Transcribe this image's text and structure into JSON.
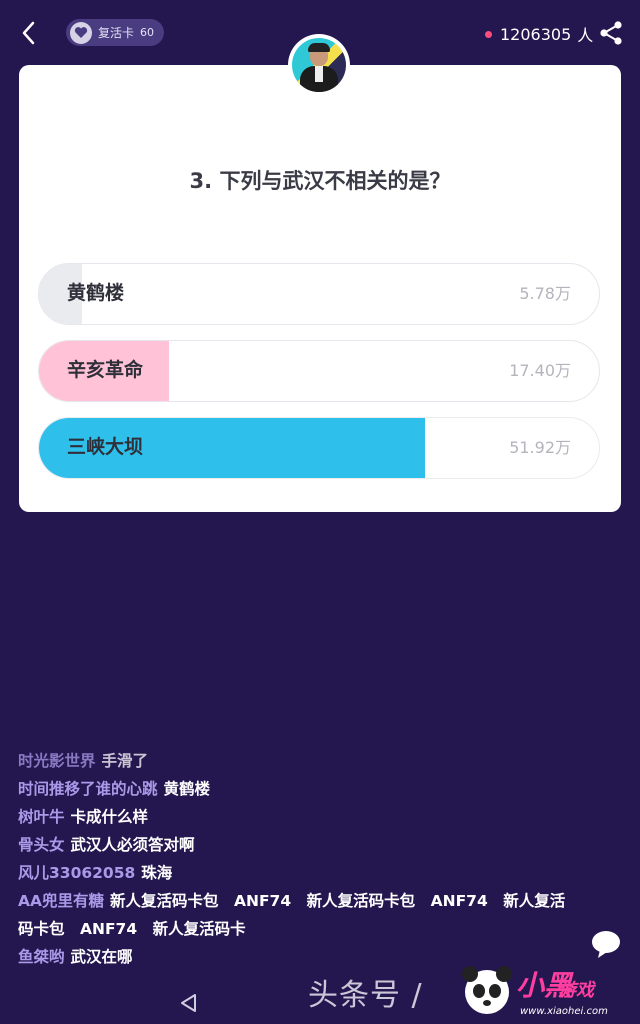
{
  "header": {
    "revive_card_label": "复活卡",
    "revive_card_count": "60",
    "online_count": "1206305",
    "online_unit": "人"
  },
  "question": {
    "text": "3. 下列与武汉不相关的是？",
    "options": [
      {
        "label": "黄鹤楼",
        "count": "5.78万",
        "fraction": 0.077,
        "color": "#e9ebef"
      },
      {
        "label": "辛亥革命",
        "count": "17.40万",
        "fraction": 0.232,
        "color": "#ffc2d6"
      },
      {
        "label": "三峡大坝",
        "count": "51.92万",
        "fraction": 0.69,
        "color": "#2ec0ea"
      }
    ]
  },
  "chat": {
    "messages": [
      {
        "user": "时光影世界",
        "text": "手滑了"
      },
      {
        "user": "时间推移了谁的心跳",
        "text": "黄鹤楼"
      },
      {
        "user": "树叶牛",
        "text": "卡成什么样"
      },
      {
        "user": "骨头女",
        "text": "武汉人必须答对啊"
      },
      {
        "user": "风儿33062058",
        "text": "珠海"
      },
      {
        "user": "AA兜里有糖",
        "text": "新人复活码卡包　ANF74　新人复活码卡包　ANF74　新人复活码卡包　ANF74　新人复活码卡"
      },
      {
        "user": "鱼桀哟",
        "text": "武汉在哪"
      }
    ]
  },
  "watermark": {
    "text": "头条号 /",
    "brand": "小黑",
    "brand_suffix": "游戏",
    "url": "www.xiaohei.com"
  },
  "icons": {
    "back": "chevron-left-icon",
    "heart": "heart-icon",
    "share": "share-icon",
    "chat": "chat-bubble-icon",
    "nav_back": "nav-back-triangle-icon"
  },
  "colors": {
    "background": "#24174f",
    "online_dot": "#ff4d7e",
    "username": "#a89ae8",
    "accent_blue": "#2ec0ea",
    "accent_pink": "#ffc2d6"
  }
}
